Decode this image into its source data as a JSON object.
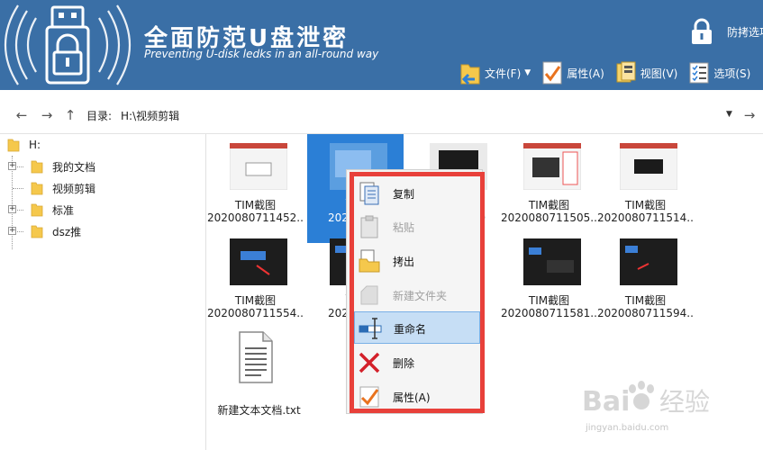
{
  "app": {
    "title": "全面防范U盘泄密",
    "subtitle": "Preventing U-disk ledks in an all-round way",
    "anti_copy_label": "防拷选项"
  },
  "toolbar": {
    "file_label": "文件(F)",
    "properties_label": "属性(A)",
    "view_label": "视图(V)",
    "options_label": "选项(S)"
  },
  "address": {
    "label": "目录:",
    "path": "H:\\视频剪辑"
  },
  "tree": {
    "root": "H:",
    "items": [
      {
        "label": "我的文档",
        "expandable": true
      },
      {
        "label": "视频剪辑",
        "expandable": false
      },
      {
        "label": "标准",
        "expandable": true
      },
      {
        "label": "dsz推",
        "expandable": true
      }
    ]
  },
  "files": [
    {
      "line1": "TIM截图",
      "line2": "2020080711452..."
    },
    {
      "line1": "TIM",
      "line2": "20200807"
    },
    {
      "line1": "",
      "line2": "0"
    },
    {
      "line1": "TIM截图",
      "line2": "2020080711505..."
    },
    {
      "line1": "TIM截图",
      "line2": "2020080711514..."
    },
    {
      "line1": "TIM截图",
      "line2": "2020080711554..."
    },
    {
      "line1": "TIM",
      "line2": "20200807"
    },
    {
      "line1": "",
      "line2": "5"
    },
    {
      "line1": "TIM截图",
      "line2": "2020080711581..."
    },
    {
      "line1": "TIM截图",
      "line2": "2020080711594..."
    },
    {
      "line1": "",
      "line2": "新建文本文档.txt"
    }
  ],
  "context_menu": {
    "items": [
      {
        "label": "复制",
        "disabled": false
      },
      {
        "label": "粘贴",
        "disabled": true
      },
      {
        "label": "拷出",
        "disabled": false
      },
      {
        "label": "新建文件夹",
        "disabled": true
      },
      {
        "label": "重命名",
        "disabled": false,
        "highlighted": true
      },
      {
        "label": "删除",
        "disabled": false
      },
      {
        "label": "属性(A)",
        "disabled": false
      }
    ]
  },
  "watermark": {
    "brand": "Bai度经验",
    "url": "jingyan.baidu.com"
  },
  "colors": {
    "header_bg": "#3a6fa6",
    "selection": "#2b7fd6",
    "context_border": "#e8403a",
    "menu_hover": "#c6def5"
  }
}
